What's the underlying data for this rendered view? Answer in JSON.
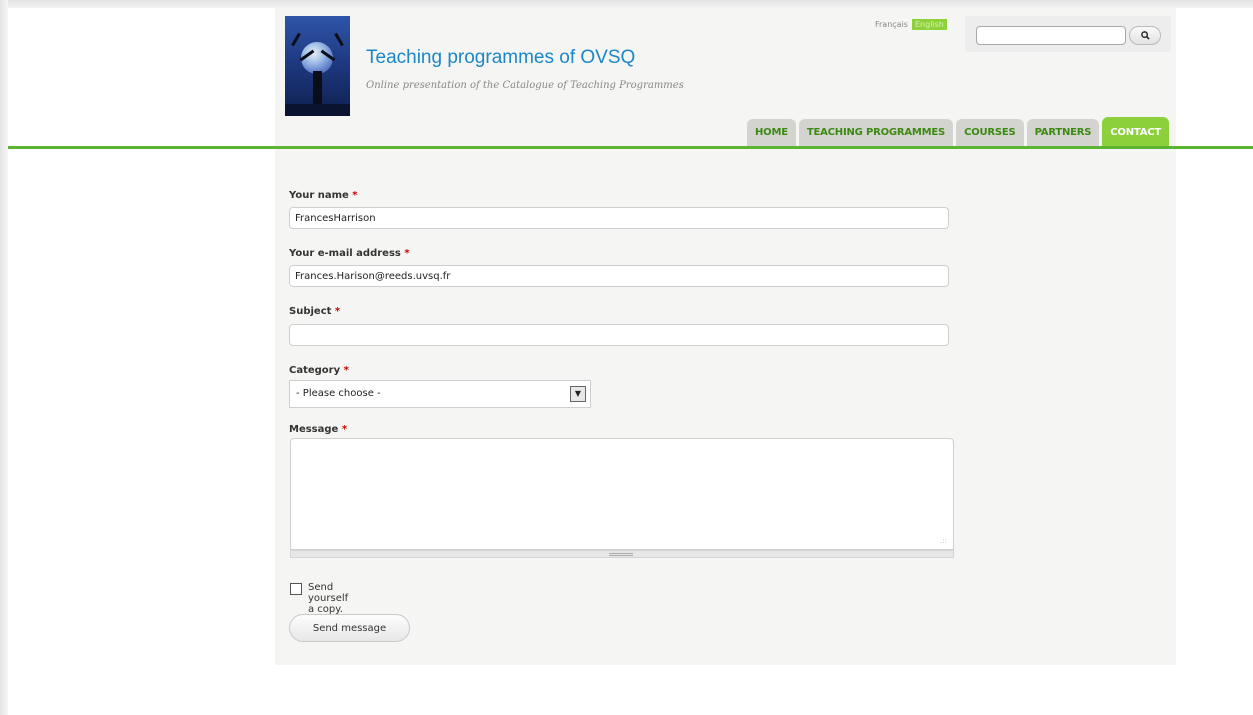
{
  "site": {
    "title": "Teaching programmes of OVSQ",
    "slogan": "Online presentation of the Catalogue of Teaching Programmes"
  },
  "language": {
    "french": "Français",
    "english": "English"
  },
  "search": {
    "value": "",
    "button_icon": "search-icon"
  },
  "nav": {
    "tabs": [
      {
        "label": "HOME",
        "active": false
      },
      {
        "label": "TEACHING PROGRAMMES",
        "active": false
      },
      {
        "label": "COURSES",
        "active": false
      },
      {
        "label": "PARTNERS",
        "active": false
      },
      {
        "label": "CONTACT",
        "active": true
      }
    ]
  },
  "form": {
    "name": {
      "label": "Your name",
      "required": "*",
      "value": "FrancesHarrison"
    },
    "email": {
      "label": "Your e-mail address",
      "required": "*",
      "value": "Frances.Harison@reeds.uvsq.fr"
    },
    "subject": {
      "label": "Subject",
      "required": "*",
      "value": ""
    },
    "category": {
      "label": "Category",
      "required": "*",
      "selected": "- Please choose -"
    },
    "message": {
      "label": "Message",
      "required": "*",
      "value": ""
    },
    "copy": {
      "label": "Send yourself a copy.",
      "checked": false
    },
    "submit_label": "Send message"
  },
  "colors": {
    "accent_green": "#8cd13b",
    "title_blue": "#1a87c8",
    "tab_text": "#3c8a12"
  }
}
